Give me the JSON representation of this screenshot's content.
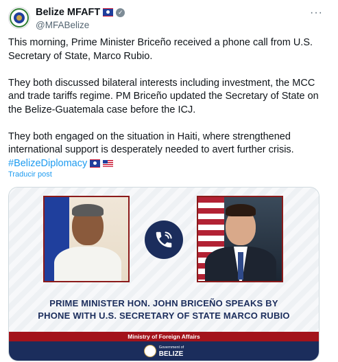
{
  "header": {
    "display_name": "Belize MFAFT",
    "handle": "@MFABelize",
    "more_label": "···"
  },
  "post": {
    "paragraph1": "This morning, Prime Minister Briceño received a phone call from U.S. Secretary of State, Marco Rubio.",
    "paragraph2": "They both discussed bilateral interests including investment, the MCC and trade tariffs regime. PM Briceño updated the Secretary of State on the Belize-Guatemala case before the ICJ.",
    "paragraph3": "They both engaged on the situation in Haiti, where strengthened international support is desperately needed to avert further crisis.",
    "hashtag": "#BelizeDiplomacy",
    "translate_label": "Traducir post"
  },
  "media": {
    "headline_line1": "PRIME MINISTER HON. JOHN BRICEÑO SPEAKS BY",
    "headline_line2": "PHONE WITH U.S. SECRETARY OF STATE MARCO RUBIO",
    "ministry_label": "Ministry of Foreign Affairs",
    "gov_small": "Government of",
    "gov_big": "BELIZE"
  },
  "icons": {
    "verified": "verified-badge-icon",
    "phone": "phone-call-icon",
    "more": "more-options-icon"
  },
  "colors": {
    "link": "#1d9bf0",
    "navy": "#1b2d5c",
    "red": "#a3131b",
    "secondary_text": "#536471"
  }
}
